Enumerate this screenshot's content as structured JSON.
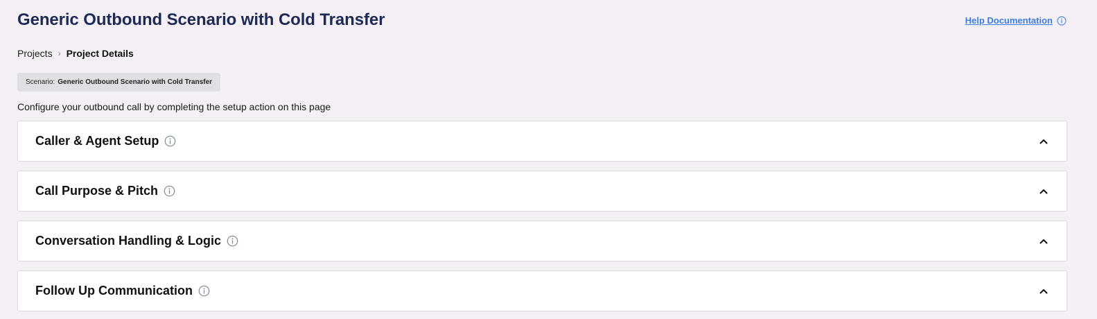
{
  "header": {
    "title": "Generic Outbound Scenario with Cold Transfer",
    "help_link": "Help Documentation"
  },
  "breadcrumb": {
    "items": [
      {
        "label": "Projects"
      },
      {
        "label": "Project Details"
      }
    ]
  },
  "scenario": {
    "label": "Scenario:",
    "value": "Generic Outbound Scenario with Cold Transfer"
  },
  "intro": "Configure your outbound call by completing the setup action on this page",
  "sections": [
    {
      "title": "Caller & Agent Setup",
      "icon": "chevron-up-icon"
    },
    {
      "title": "Call Purpose & Pitch",
      "icon": "chevron-up-icon"
    },
    {
      "title": "Conversation Handling & Logic",
      "icon": "chevron-up-icon"
    },
    {
      "title": "Follow Up Communication",
      "icon": "chevron-up-icon"
    }
  ],
  "colors": {
    "background": "#f4f0f5",
    "title": "#1c2a55",
    "link": "#3b7ddd",
    "chip": "#e1dfe3"
  }
}
